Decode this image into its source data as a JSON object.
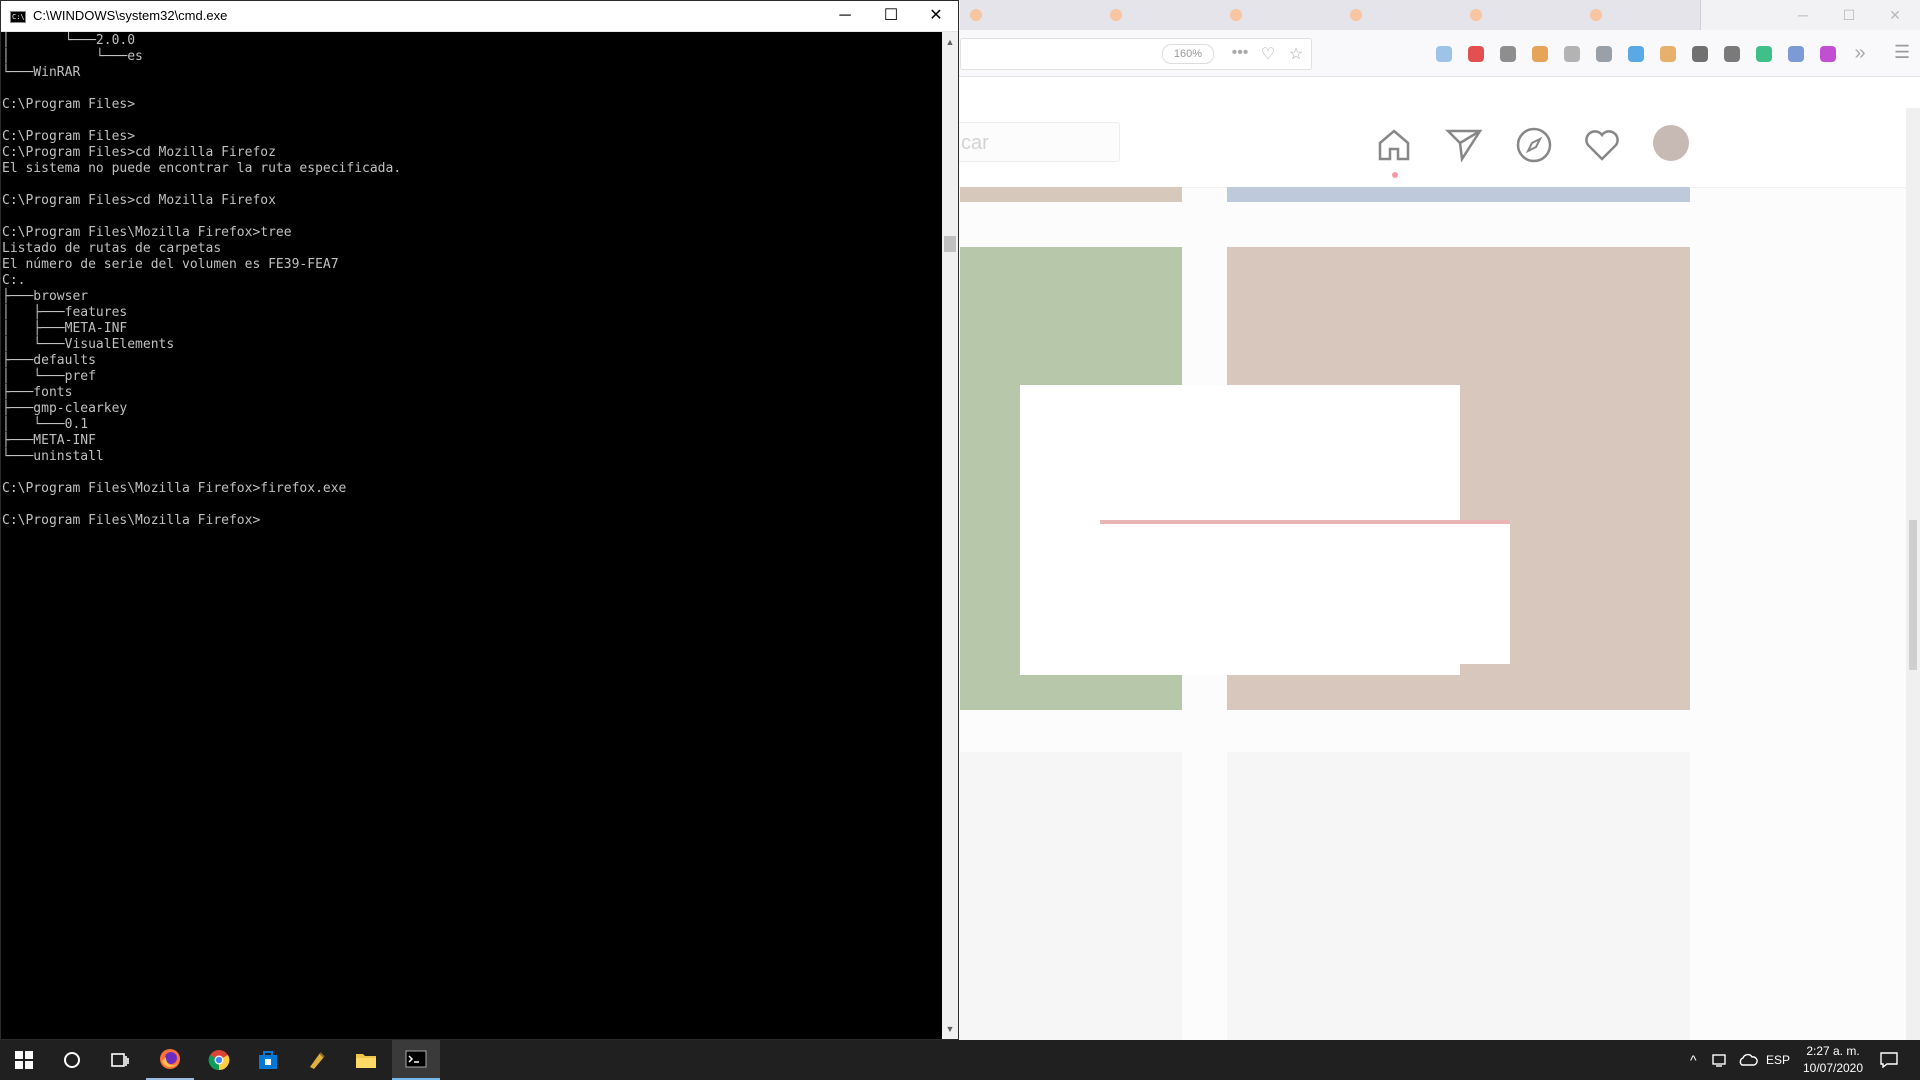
{
  "cmd": {
    "title": "C:\\WINDOWS\\system32\\cmd.exe",
    "title_icon_text": "C:\\",
    "buttons": {
      "minimize": "─",
      "maximize": "☐",
      "close": "✕"
    },
    "lines": [
      "│       └───2.0.0",
      "│           └───es",
      "└───WinRAR",
      "",
      "C:\\Program Files>",
      "",
      "C:\\Program Files>",
      "C:\\Program Files>cd Mozilla Firefoz",
      "El sistema no puede encontrar la ruta especificada.",
      "",
      "C:\\Program Files>cd Mozilla Firefox",
      "",
      "C:\\Program Files\\Mozilla Firefox>tree",
      "Listado de rutas de carpetas",
      "El número de serie del volumen es FE39-FEA7",
      "C:.",
      "├───browser",
      "│   ├───features",
      "│   ├───META-INF",
      "│   └───VisualElements",
      "├───defaults",
      "│   └───pref",
      "├───fonts",
      "├───gmp-clearkey",
      "│   └───0.1",
      "├───META-INF",
      "└───uninstall",
      "",
      "C:\\Program Files\\Mozilla Firefox>firefox.exe",
      "",
      "C:\\Program Files\\Mozilla Firefox>"
    ]
  },
  "browser": {
    "zoom": "160%",
    "page_actions": {
      "more": "•••",
      "pocket": "♡",
      "bookmark": "☆"
    },
    "overflow": "»",
    "menu": "☰",
    "win_buttons": {
      "minimize": "─",
      "maximize": "☐",
      "close": "✕"
    },
    "search_placeholder": "car",
    "extension_colors": [
      "#9ec3e8",
      "#e35050",
      "#8e8e8e",
      "#e8a35a",
      "#b3b3b3",
      "#9aa0a8",
      "#5aa9e6",
      "#e8b06a",
      "#707070",
      "#7a7a7a",
      "#3fbf8a",
      "#7c9ad6",
      "#c24fd1"
    ]
  },
  "taskbar": {
    "start": "⊞",
    "search": "○",
    "task_view": "⧉",
    "apps": [
      "firefox-icon",
      "chrome-icon",
      "store-icon",
      "app-icon",
      "file-explorer-icon",
      "cmd-icon"
    ],
    "tray_chevron": "^",
    "language": "ESP",
    "time": "2:27 a. m.",
    "date": "10/07/2020"
  }
}
